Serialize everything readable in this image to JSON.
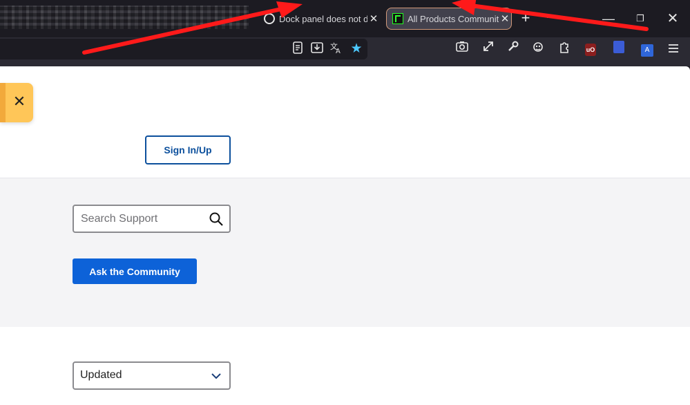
{
  "browser": {
    "tabs": [
      {
        "title": "Dock panel does not di",
        "close": "✕"
      },
      {
        "title": "All Products Community",
        "close": "✕"
      }
    ],
    "new_tab": "+",
    "list_all_tabs": "⌄",
    "window": {
      "minimize": "—",
      "restore": "❐",
      "close": "✕"
    },
    "url_icons": {
      "reader": "reader-view-icon",
      "download": "download-icon",
      "translate": "translate-icon",
      "bookmark": "star-icon"
    },
    "toolbar_icons": [
      "camera-icon",
      "expand-icon",
      "wrench-icon",
      "extension-fox-icon",
      "puzzle-icon",
      "ublock-icon",
      "privacy-icon",
      "translate-ext-icon",
      "menu-icon"
    ],
    "ublock_label": "uO",
    "translate_ext_label": "A"
  },
  "page": {
    "toast_close": "✕",
    "sign_in_label": "Sign In/Up",
    "search": {
      "placeholder": "Search Support"
    },
    "ask_label": "Ask the Community",
    "sort": {
      "selected": "Updated"
    }
  },
  "colors": {
    "annotation_arrow": "#ff1a1a",
    "primary_button": "#0d62d8",
    "accent_outline": "#0b4f9c",
    "toast": "#ffc658"
  }
}
